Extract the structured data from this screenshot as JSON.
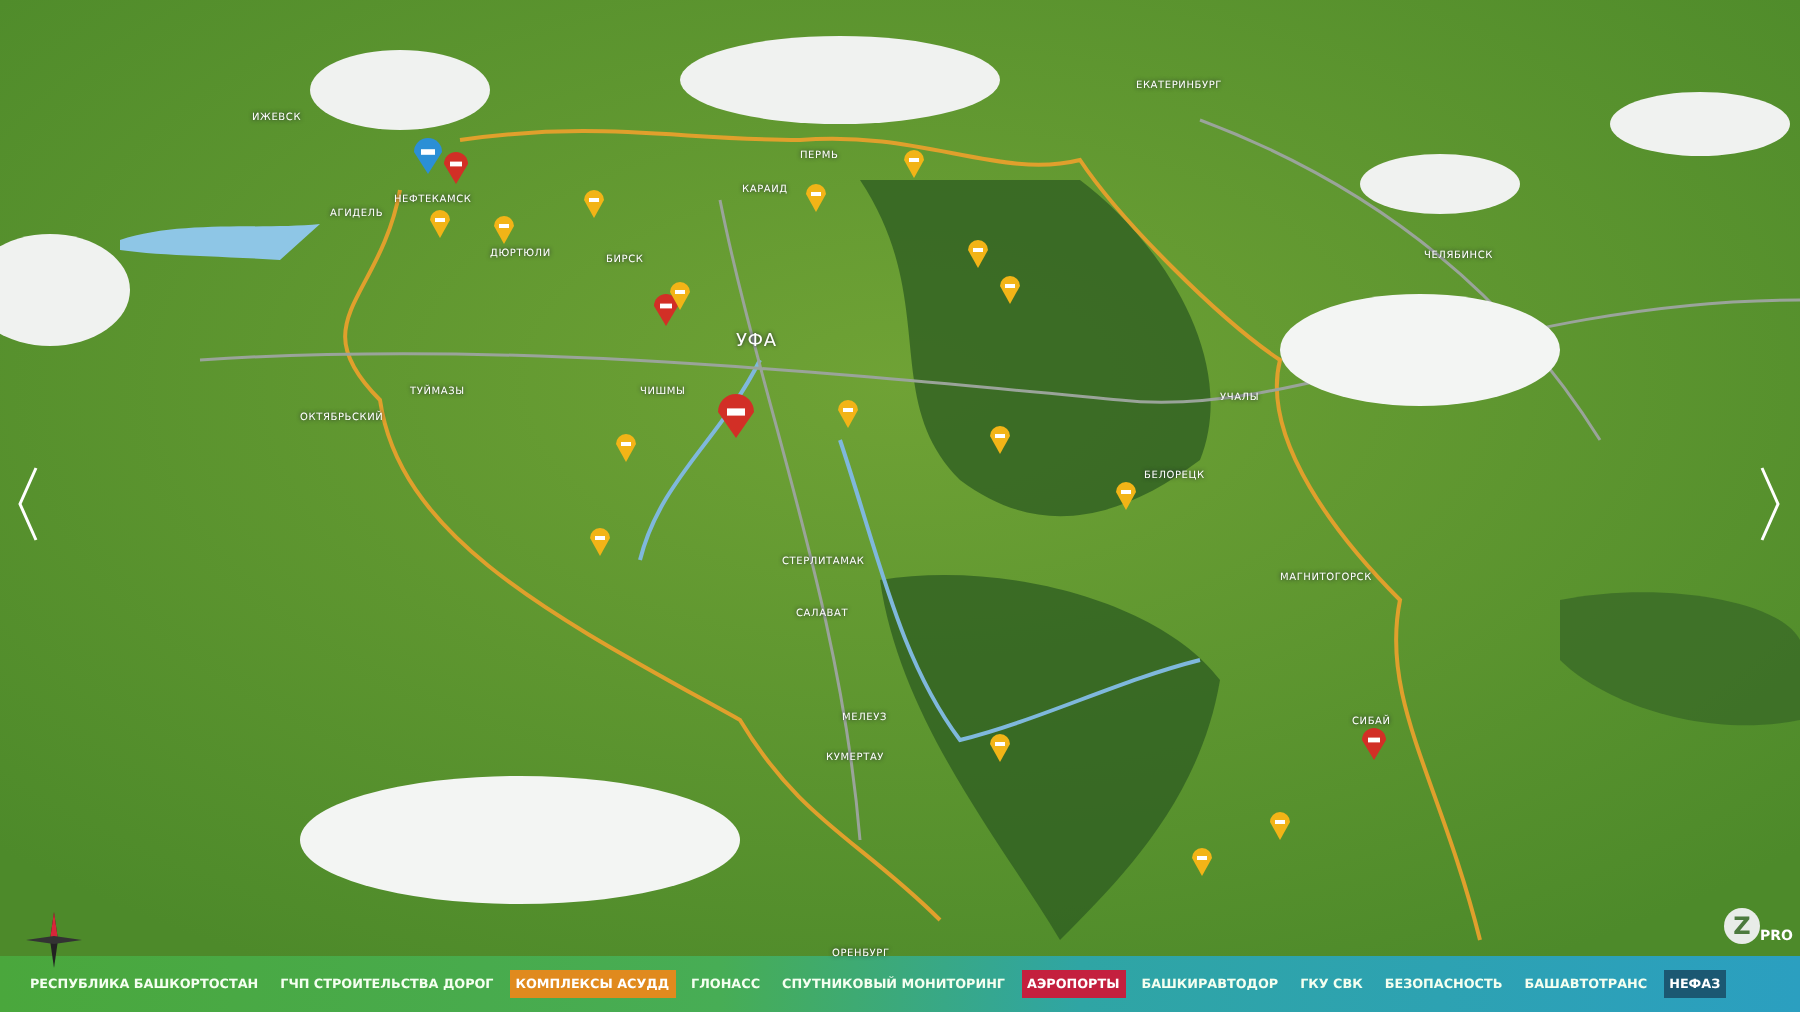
{
  "map": {
    "cities": [
      {
        "label": "ИЖЕВСК"
      },
      {
        "label": "ПЕРМЬ"
      },
      {
        "label": "ЕКАТЕРИНБУРГ"
      },
      {
        "label": "НЕФТЕКАМСК"
      },
      {
        "label": "АГИДЕЛЬ"
      },
      {
        "label": "ДЮРТЮЛИ"
      },
      {
        "label": "БИРСК"
      },
      {
        "label": "КАРАИД"
      },
      {
        "label": "УФА"
      },
      {
        "label": "ТУЙМАЗЫ"
      },
      {
        "label": "ОКТЯБРЬСКИЙ"
      },
      {
        "label": "ЧИШМЫ"
      },
      {
        "label": "ЧЕЛЯБИНСК"
      },
      {
        "label": "УЧАЛЫ"
      },
      {
        "label": "БЕЛОРЕЦК"
      },
      {
        "label": "СТЕРЛИТАМАК"
      },
      {
        "label": "САЛАВАТ"
      },
      {
        "label": "МАГНИТОГОРСК"
      },
      {
        "label": "МЕЛЕУЗ"
      },
      {
        "label": "КУМЕРТАУ"
      },
      {
        "label": "СИБАЙ"
      },
      {
        "label": "ОРЕНБУРГ"
      }
    ],
    "pins": [
      {
        "kind": "factory"
      },
      {
        "kind": "airport"
      },
      {
        "kind": "airport"
      },
      {
        "kind": "airport"
      },
      {
        "kind": "airport"
      },
      {
        "kind": "complex"
      },
      {
        "kind": "complex"
      },
      {
        "kind": "complex"
      },
      {
        "kind": "complex"
      },
      {
        "kind": "complex"
      },
      {
        "kind": "complex"
      },
      {
        "kind": "complex"
      },
      {
        "kind": "complex"
      },
      {
        "kind": "complex"
      },
      {
        "kind": "complex"
      },
      {
        "kind": "complex"
      },
      {
        "kind": "complex"
      },
      {
        "kind": "complex"
      },
      {
        "kind": "complex"
      },
      {
        "kind": "complex"
      },
      {
        "kind": "complex"
      }
    ]
  },
  "nav": [
    {
      "label": "РЕСПУБЛИКА БАШКОРТОСТАН",
      "on": false
    },
    {
      "label": "ГЧП СТРОИТЕЛЬСТВА ДОРОГ",
      "on": false
    },
    {
      "label": "КОМПЛЕКСЫ АСУДД",
      "on": true,
      "color": "#e08a1e"
    },
    {
      "label": "ГЛОНАСС",
      "on": false
    },
    {
      "label": "СПУТНИКОВЫЙ МОНИТОРИНГ",
      "on": false
    },
    {
      "label": "АЭРОПОРТЫ",
      "on": true,
      "color": "#c4203e"
    },
    {
      "label": "БАШКИРАВТОДОР",
      "on": false
    },
    {
      "label": "ГКУ СВК",
      "on": false
    },
    {
      "label": "БЕЗОПАСНОСТЬ",
      "on": false
    },
    {
      "label": "БАШАВТОТРАНС",
      "on": false
    },
    {
      "label": "НЕФАЗ",
      "on": true,
      "color": "#1b5872"
    }
  ],
  "logo": {
    "mark": "Z",
    "text": "PRO"
  }
}
